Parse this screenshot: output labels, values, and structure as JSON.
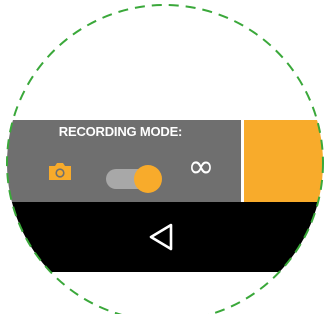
{
  "recording_mode": {
    "title": "RECORDING MODE:",
    "photo_icon": "camera-icon",
    "continuous_icon": "infinity-icon",
    "continuous_glyph": "∞",
    "toggle_state": "continuous"
  },
  "nav_bar": {
    "back_icon": "back-triangle-icon"
  },
  "colors": {
    "accent": "#f8ab2b",
    "panel": "#6f6f6f",
    "nav_bar": "#000000",
    "zoom_circle_dash": "#3aa83a"
  }
}
